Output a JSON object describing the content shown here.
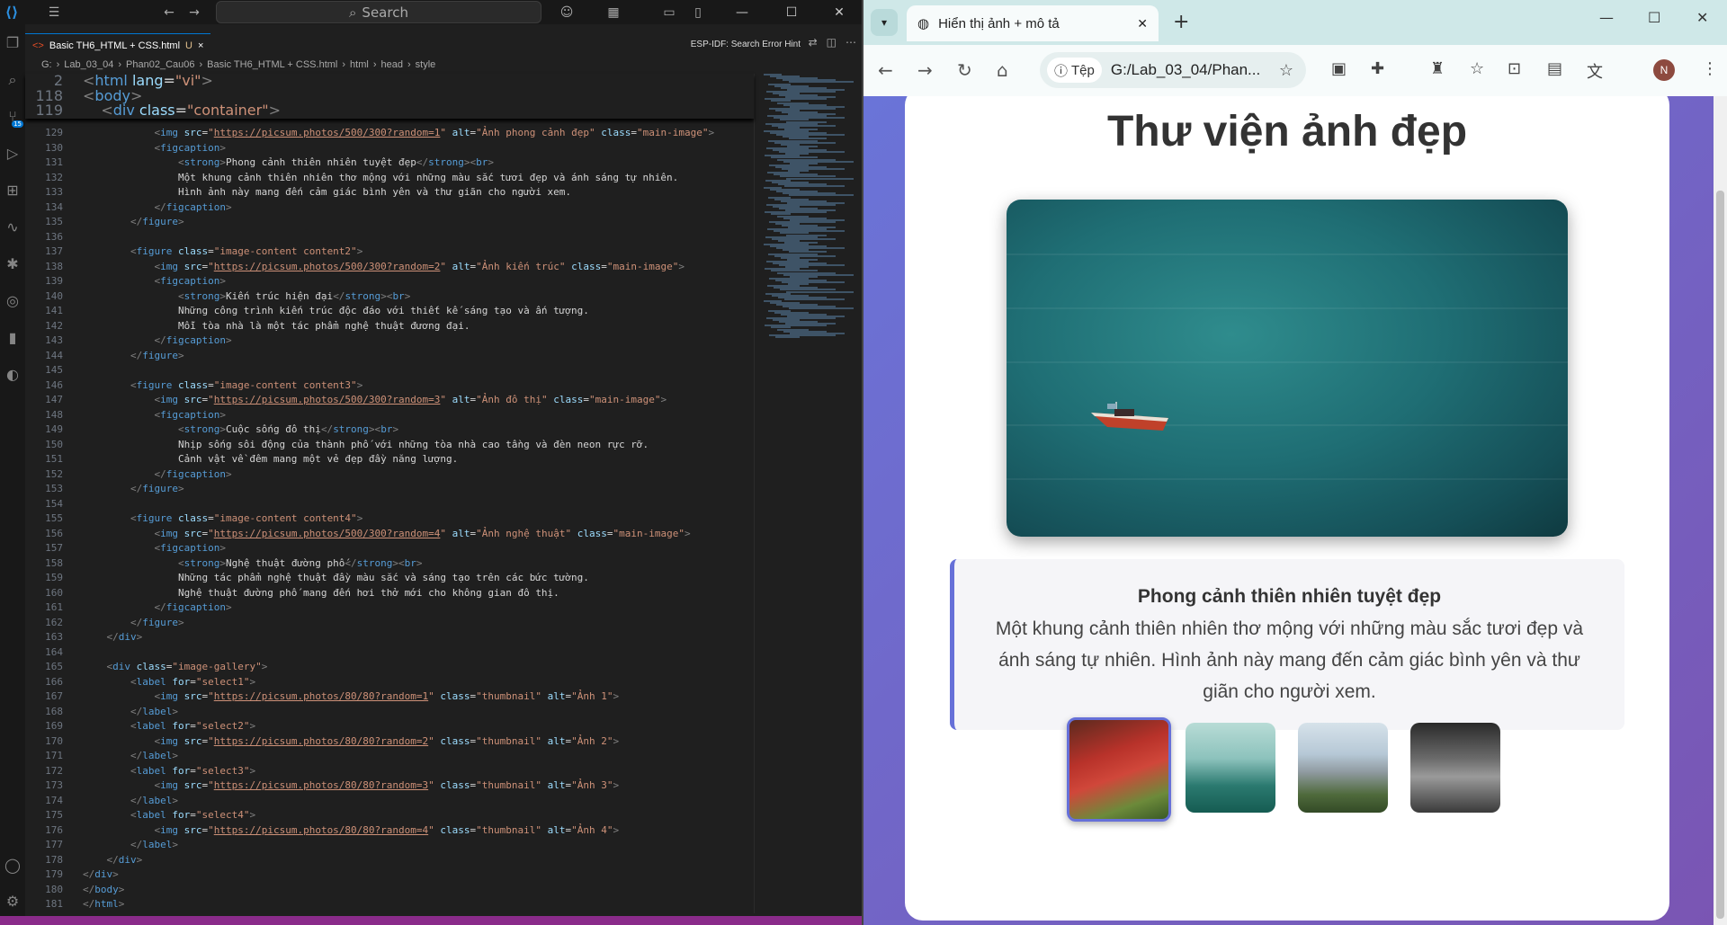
{
  "vscode": {
    "search_label": "Search",
    "tab_label": "Basic TH6_HTML + CSS.html",
    "tab_modified": "U",
    "tab_close": "×",
    "esp_hint": "ESP-IDF: Search Error Hint",
    "badge": "15",
    "breadcrumb": [
      "G:",
      "Lab_03_04",
      "Phan02_Cau06",
      "Basic TH6_HTML + CSS.html",
      "html",
      "head",
      "style"
    ],
    "sticky": [
      {
        "n": "2",
        "html": "<span class='tg'>&lt;</span><span class='tn'>html</span> <span class='at'>lang</span>=<span class='st'>\"vi\"</span><span class='tg'>&gt;</span>"
      },
      {
        "n": "118",
        "html": "<span class='tg'>&lt;</span><span class='tn'>body</span><span class='tg'>&gt;</span>"
      },
      {
        "n": "119",
        "html": "    <span class='tg'>&lt;</span><span class='tn'>div</span> <span class='at'>class</span>=<span class='st'>\"container\"</span><span class='tg'>&gt;</span>"
      }
    ],
    "lines": [
      {
        "n": "129",
        "html": "            <span class='tg'>&lt;</span><span class='tn'>img</span> <span class='at'>src</span>=<span class='st'>\"</span><span class='lk'>https://picsum.photos/500/300?random=1</span><span class='st'>\"</span> <span class='at'>alt</span>=<span class='st'>\"Ảnh phong cảnh đẹp\"</span> <span class='at'>class</span>=<span class='st'>\"main-image\"</span><span class='tg'>&gt;</span>"
      },
      {
        "n": "130",
        "html": "            <span class='tg'>&lt;</span><span class='tn'>figcaption</span><span class='tg'>&gt;</span>"
      },
      {
        "n": "131",
        "html": "                <span class='tg'>&lt;</span><span class='tn'>strong</span><span class='tg'>&gt;</span>Phong cảnh thiên nhiên tuyệt đẹp<span class='tg'>&lt;/</span><span class='tn'>strong</span><span class='tg'>&gt;&lt;</span><span class='tn'>br</span><span class='tg'>&gt;</span>"
      },
      {
        "n": "132",
        "html": "                Một khung cảnh thiên nhiên thơ mộng với những màu sắc tươi đẹp và ánh sáng tự nhiên."
      },
      {
        "n": "133",
        "html": "                Hình ảnh này mang đến cảm giác bình yên và thư giãn cho người xem."
      },
      {
        "n": "134",
        "html": "            <span class='tg'>&lt;/</span><span class='tn'>figcaption</span><span class='tg'>&gt;</span>"
      },
      {
        "n": "135",
        "html": "        <span class='tg'>&lt;/</span><span class='tn'>figure</span><span class='tg'>&gt;</span>"
      },
      {
        "n": "136",
        "html": ""
      },
      {
        "n": "137",
        "html": "        <span class='tg'>&lt;</span><span class='tn'>figure</span> <span class='at'>class</span>=<span class='st'>\"image-content content2\"</span><span class='tg'>&gt;</span>"
      },
      {
        "n": "138",
        "html": "            <span class='tg'>&lt;</span><span class='tn'>img</span> <span class='at'>src</span>=<span class='st'>\"</span><span class='lk'>https://picsum.photos/500/300?random=2</span><span class='st'>\"</span> <span class='at'>alt</span>=<span class='st'>\"Ảnh kiến trúc\"</span> <span class='at'>class</span>=<span class='st'>\"main-image\"</span><span class='tg'>&gt;</span>"
      },
      {
        "n": "139",
        "html": "            <span class='tg'>&lt;</span><span class='tn'>figcaption</span><span class='tg'>&gt;</span>"
      },
      {
        "n": "140",
        "html": "                <span class='tg'>&lt;</span><span class='tn'>strong</span><span class='tg'>&gt;</span>Kiến trúc hiện đại<span class='tg'>&lt;/</span><span class='tn'>strong</span><span class='tg'>&gt;&lt;</span><span class='tn'>br</span><span class='tg'>&gt;</span>"
      },
      {
        "n": "141",
        "html": "                Những công trình kiến trúc độc đáo với thiết kế sáng tạo và ấn tượng."
      },
      {
        "n": "142",
        "html": "                Mỗi tòa nhà là một tác phẩm nghệ thuật đương đại."
      },
      {
        "n": "143",
        "html": "            <span class='tg'>&lt;/</span><span class='tn'>figcaption</span><span class='tg'>&gt;</span>"
      },
      {
        "n": "144",
        "html": "        <span class='tg'>&lt;/</span><span class='tn'>figure</span><span class='tg'>&gt;</span>"
      },
      {
        "n": "145",
        "html": ""
      },
      {
        "n": "146",
        "html": "        <span class='tg'>&lt;</span><span class='tn'>figure</span> <span class='at'>class</span>=<span class='st'>\"image-content content3\"</span><span class='tg'>&gt;</span>"
      },
      {
        "n": "147",
        "html": "            <span class='tg'>&lt;</span><span class='tn'>img</span> <span class='at'>src</span>=<span class='st'>\"</span><span class='lk'>https://picsum.photos/500/300?random=3</span><span class='st'>\"</span> <span class='at'>alt</span>=<span class='st'>\"Ảnh đô thị\"</span> <span class='at'>class</span>=<span class='st'>\"main-image\"</span><span class='tg'>&gt;</span>"
      },
      {
        "n": "148",
        "html": "            <span class='tg'>&lt;</span><span class='tn'>figcaption</span><span class='tg'>&gt;</span>"
      },
      {
        "n": "149",
        "html": "                <span class='tg'>&lt;</span><span class='tn'>strong</span><span class='tg'>&gt;</span>Cuộc sống đô thị<span class='tg'>&lt;/</span><span class='tn'>strong</span><span class='tg'>&gt;&lt;</span><span class='tn'>br</span><span class='tg'>&gt;</span>"
      },
      {
        "n": "150",
        "html": "                Nhịp sống sôi động của thành phố với những tòa nhà cao tầng và đèn neon rực rỡ."
      },
      {
        "n": "151",
        "html": "                Cảnh vật về đêm mang một vẻ đẹp đầy năng lượng."
      },
      {
        "n": "152",
        "html": "            <span class='tg'>&lt;/</span><span class='tn'>figcaption</span><span class='tg'>&gt;</span>"
      },
      {
        "n": "153",
        "html": "        <span class='tg'>&lt;/</span><span class='tn'>figure</span><span class='tg'>&gt;</span>"
      },
      {
        "n": "154",
        "html": ""
      },
      {
        "n": "155",
        "html": "        <span class='tg'>&lt;</span><span class='tn'>figure</span> <span class='at'>class</span>=<span class='st'>\"image-content content4\"</span><span class='tg'>&gt;</span>"
      },
      {
        "n": "156",
        "html": "            <span class='tg'>&lt;</span><span class='tn'>img</span> <span class='at'>src</span>=<span class='st'>\"</span><span class='lk'>https://picsum.photos/500/300?random=4</span><span class='st'>\"</span> <span class='at'>alt</span>=<span class='st'>\"Ảnh nghệ thuật\"</span> <span class='at'>class</span>=<span class='st'>\"main-image\"</span><span class='tg'>&gt;</span>"
      },
      {
        "n": "157",
        "html": "            <span class='tg'>&lt;</span><span class='tn'>figcaption</span><span class='tg'>&gt;</span>"
      },
      {
        "n": "158",
        "html": "                <span class='tg'>&lt;</span><span class='tn'>strong</span><span class='tg'>&gt;</span>Nghệ thuật đường phố<span class='tg'>&lt;/</span><span class='tn'>strong</span><span class='tg'>&gt;&lt;</span><span class='tn'>br</span><span class='tg'>&gt;</span>"
      },
      {
        "n": "159",
        "html": "                Những tác phẩm nghệ thuật đầy màu sắc và sáng tạo trên các bức tường."
      },
      {
        "n": "160",
        "html": "                Nghệ thuật đường phố mang đến hơi thở mới cho không gian đô thị."
      },
      {
        "n": "161",
        "html": "            <span class='tg'>&lt;/</span><span class='tn'>figcaption</span><span class='tg'>&gt;</span>"
      },
      {
        "n": "162",
        "html": "        <span class='tg'>&lt;/</span><span class='tn'>figure</span><span class='tg'>&gt;</span>"
      },
      {
        "n": "163",
        "html": "    <span class='tg'>&lt;/</span><span class='tn'>div</span><span class='tg'>&gt;</span>"
      },
      {
        "n": "164",
        "html": ""
      },
      {
        "n": "165",
        "html": "    <span class='tg'>&lt;</span><span class='tn'>div</span> <span class='at'>class</span>=<span class='st'>\"image-gallery\"</span><span class='tg'>&gt;</span>"
      },
      {
        "n": "166",
        "html": "        <span class='tg'>&lt;</span><span class='tn'>label</span> <span class='at'>for</span>=<span class='st'>\"select1\"</span><span class='tg'>&gt;</span>"
      },
      {
        "n": "167",
        "html": "            <span class='tg'>&lt;</span><span class='tn'>img</span> <span class='at'>src</span>=<span class='st'>\"</span><span class='lk'>https://picsum.photos/80/80?random=1</span><span class='st'>\"</span> <span class='at'>class</span>=<span class='st'>\"thumbnail\"</span> <span class='at'>alt</span>=<span class='st'>\"Ảnh 1\"</span><span class='tg'>&gt;</span>"
      },
      {
        "n": "168",
        "html": "        <span class='tg'>&lt;/</span><span class='tn'>label</span><span class='tg'>&gt;</span>"
      },
      {
        "n": "169",
        "html": "        <span class='tg'>&lt;</span><span class='tn'>label</span> <span class='at'>for</span>=<span class='st'>\"select2\"</span><span class='tg'>&gt;</span>"
      },
      {
        "n": "170",
        "html": "            <span class='tg'>&lt;</span><span class='tn'>img</span> <span class='at'>src</span>=<span class='st'>\"</span><span class='lk'>https://picsum.photos/80/80?random=2</span><span class='st'>\"</span> <span class='at'>class</span>=<span class='st'>\"thumbnail\"</span> <span class='at'>alt</span>=<span class='st'>\"Ảnh 2\"</span><span class='tg'>&gt;</span>"
      },
      {
        "n": "171",
        "html": "        <span class='tg'>&lt;/</span><span class='tn'>label</span><span class='tg'>&gt;</span>"
      },
      {
        "n": "172",
        "html": "        <span class='tg'>&lt;</span><span class='tn'>label</span> <span class='at'>for</span>=<span class='st'>\"select3\"</span><span class='tg'>&gt;</span>"
      },
      {
        "n": "173",
        "html": "            <span class='tg'>&lt;</span><span class='tn'>img</span> <span class='at'>src</span>=<span class='st'>\"</span><span class='lk'>https://picsum.photos/80/80?random=3</span><span class='st'>\"</span> <span class='at'>class</span>=<span class='st'>\"thumbnail\"</span> <span class='at'>alt</span>=<span class='st'>\"Ảnh 3\"</span><span class='tg'>&gt;</span>"
      },
      {
        "n": "174",
        "html": "        <span class='tg'>&lt;/</span><span class='tn'>label</span><span class='tg'>&gt;</span>"
      },
      {
        "n": "175",
        "html": "        <span class='tg'>&lt;</span><span class='tn'>label</span> <span class='at'>for</span>=<span class='st'>\"select4\"</span><span class='tg'>&gt;</span>"
      },
      {
        "n": "176",
        "html": "            <span class='tg'>&lt;</span><span class='tn'>img</span> <span class='at'>src</span>=<span class='st'>\"</span><span class='lk'>https://picsum.photos/80/80?random=4</span><span class='st'>\"</span> <span class='at'>class</span>=<span class='st'>\"thumbnail\"</span> <span class='at'>alt</span>=<span class='st'>\"Ảnh 4\"</span><span class='tg'>&gt;</span>"
      },
      {
        "n": "177",
        "html": "        <span class='tg'>&lt;/</span><span class='tn'>label</span><span class='tg'>&gt;</span>"
      },
      {
        "n": "178",
        "html": "    <span class='tg'>&lt;/</span><span class='tn'>div</span><span class='tg'>&gt;</span>"
      },
      {
        "n": "179",
        "html": "<span class='tg'>&lt;/</span><span class='tn'>div</span><span class='tg'>&gt;</span>"
      },
      {
        "n": "180",
        "html": "<span class='tg'>&lt;/</span><span class='tn'>body</span><span class='tg'>&gt;</span>"
      },
      {
        "n": "181",
        "html": "<span class='tg'>&lt;/</span><span class='tn'>html</span><span class='tg'>&gt;</span>"
      }
    ]
  },
  "browser": {
    "tab_title": "Hiển thị ảnh + mô tả",
    "tab_close": "✕",
    "new_tab": "+",
    "chip_label": "Tệp",
    "url": "G:/Lab_03_04/Phan...",
    "profile_initial": "N"
  },
  "page": {
    "heading": "Thư viện ảnh đẹp",
    "caption_title": "Phong cảnh thiên nhiên tuyệt đẹp",
    "caption_text": "Một khung cảnh thiên nhiên thơ mộng với những màu sắc tươi đẹp và ánh sáng tự nhiên. Hình ảnh này mang đến cảm giác bình yên và thư giãn cho người xem.",
    "thumbnails": [
      "Ảnh 1",
      "Ảnh 2",
      "Ảnh 3",
      "Ảnh 4"
    ],
    "selected_thumbnail": 1
  },
  "colors": {
    "accent": "#6670d8",
    "vscode_bg": "#1f1f1f",
    "page_bg_start": "#6a74d8",
    "page_bg_end": "#7a55b3"
  }
}
